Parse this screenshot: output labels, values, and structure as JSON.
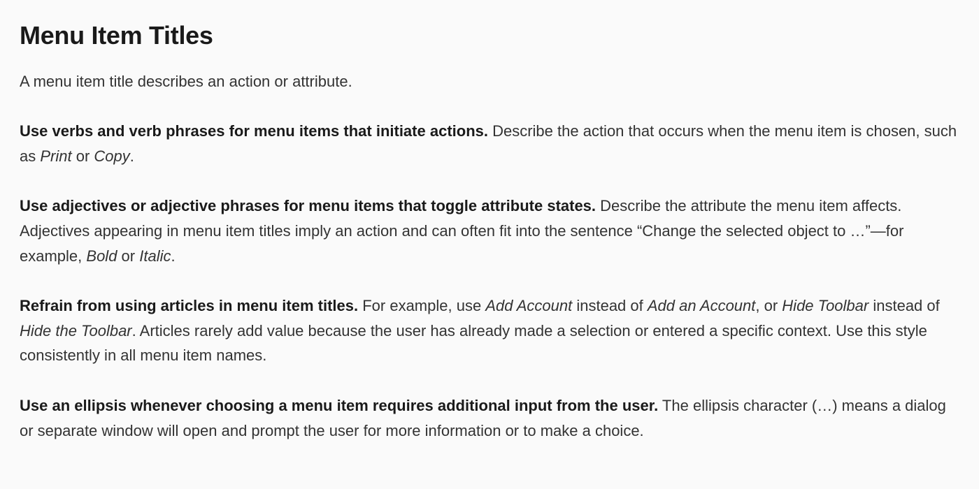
{
  "title": "Menu Item Titles",
  "intro": "A menu item title describes an action or attribute.",
  "g1": {
    "lead": "Use verbs and verb phrases for menu items that initiate actions.",
    "body1": " Describe the action that occurs when the menu item is chosen, such as ",
    "em1": "Print",
    "body2": " or ",
    "em2": "Copy",
    "body3": "."
  },
  "g2": {
    "lead": "Use adjectives or adjective phrases for menu items that toggle attribute states.",
    "body1": " Describe the attribute the menu item affects. Adjectives appearing in menu item titles imply an action and can often fit into the sentence “Change the selected object to …”—for example, ",
    "em1": "Bold",
    "body2": " or ",
    "em2": "Italic",
    "body3": "."
  },
  "g3": {
    "lead": "Refrain from using articles in menu item titles.",
    "body1": " For example, use ",
    "em1": "Add Account",
    "body2": " instead of ",
    "em2": "Add an Account",
    "body3": ", or ",
    "em3": "Hide Toolbar",
    "body4": " instead of ",
    "em4": "Hide the Toolbar",
    "body5": ". Articles rarely add value because the user has already made a selection or entered a specific context. Use this style consistently in all menu item names."
  },
  "g4": {
    "lead": "Use an ellipsis whenever choosing a menu item requires additional input from the user.",
    "body1": " The ellipsis character (…) means a dialog or separate window will open and prompt the user for more information or to make a choice."
  }
}
